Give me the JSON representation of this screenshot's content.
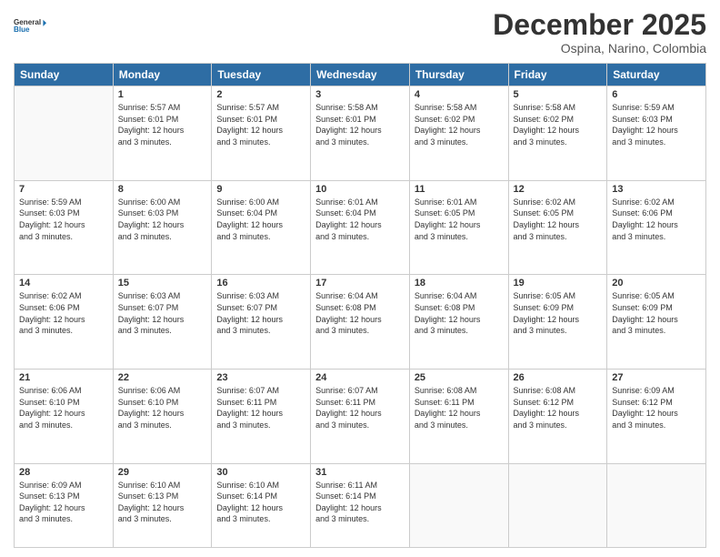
{
  "logo": {
    "line1": "General",
    "line2": "Blue"
  },
  "title": "December 2025",
  "subtitle": "Ospina, Narino, Colombia",
  "weekdays": [
    "Sunday",
    "Monday",
    "Tuesday",
    "Wednesday",
    "Thursday",
    "Friday",
    "Saturday"
  ],
  "weeks": [
    [
      {
        "day": "",
        "info": ""
      },
      {
        "day": "1",
        "info": "Sunrise: 5:57 AM\nSunset: 6:01 PM\nDaylight: 12 hours\nand 3 minutes."
      },
      {
        "day": "2",
        "info": "Sunrise: 5:57 AM\nSunset: 6:01 PM\nDaylight: 12 hours\nand 3 minutes."
      },
      {
        "day": "3",
        "info": "Sunrise: 5:58 AM\nSunset: 6:01 PM\nDaylight: 12 hours\nand 3 minutes."
      },
      {
        "day": "4",
        "info": "Sunrise: 5:58 AM\nSunset: 6:02 PM\nDaylight: 12 hours\nand 3 minutes."
      },
      {
        "day": "5",
        "info": "Sunrise: 5:58 AM\nSunset: 6:02 PM\nDaylight: 12 hours\nand 3 minutes."
      },
      {
        "day": "6",
        "info": "Sunrise: 5:59 AM\nSunset: 6:03 PM\nDaylight: 12 hours\nand 3 minutes."
      }
    ],
    [
      {
        "day": "7",
        "info": "Sunrise: 5:59 AM\nSunset: 6:03 PM\nDaylight: 12 hours\nand 3 minutes."
      },
      {
        "day": "8",
        "info": "Sunrise: 6:00 AM\nSunset: 6:03 PM\nDaylight: 12 hours\nand 3 minutes."
      },
      {
        "day": "9",
        "info": "Sunrise: 6:00 AM\nSunset: 6:04 PM\nDaylight: 12 hours\nand 3 minutes."
      },
      {
        "day": "10",
        "info": "Sunrise: 6:01 AM\nSunset: 6:04 PM\nDaylight: 12 hours\nand 3 minutes."
      },
      {
        "day": "11",
        "info": "Sunrise: 6:01 AM\nSunset: 6:05 PM\nDaylight: 12 hours\nand 3 minutes."
      },
      {
        "day": "12",
        "info": "Sunrise: 6:02 AM\nSunset: 6:05 PM\nDaylight: 12 hours\nand 3 minutes."
      },
      {
        "day": "13",
        "info": "Sunrise: 6:02 AM\nSunset: 6:06 PM\nDaylight: 12 hours\nand 3 minutes."
      }
    ],
    [
      {
        "day": "14",
        "info": "Sunrise: 6:02 AM\nSunset: 6:06 PM\nDaylight: 12 hours\nand 3 minutes."
      },
      {
        "day": "15",
        "info": "Sunrise: 6:03 AM\nSunset: 6:07 PM\nDaylight: 12 hours\nand 3 minutes."
      },
      {
        "day": "16",
        "info": "Sunrise: 6:03 AM\nSunset: 6:07 PM\nDaylight: 12 hours\nand 3 minutes."
      },
      {
        "day": "17",
        "info": "Sunrise: 6:04 AM\nSunset: 6:08 PM\nDaylight: 12 hours\nand 3 minutes."
      },
      {
        "day": "18",
        "info": "Sunrise: 6:04 AM\nSunset: 6:08 PM\nDaylight: 12 hours\nand 3 minutes."
      },
      {
        "day": "19",
        "info": "Sunrise: 6:05 AM\nSunset: 6:09 PM\nDaylight: 12 hours\nand 3 minutes."
      },
      {
        "day": "20",
        "info": "Sunrise: 6:05 AM\nSunset: 6:09 PM\nDaylight: 12 hours\nand 3 minutes."
      }
    ],
    [
      {
        "day": "21",
        "info": "Sunrise: 6:06 AM\nSunset: 6:10 PM\nDaylight: 12 hours\nand 3 minutes."
      },
      {
        "day": "22",
        "info": "Sunrise: 6:06 AM\nSunset: 6:10 PM\nDaylight: 12 hours\nand 3 minutes."
      },
      {
        "day": "23",
        "info": "Sunrise: 6:07 AM\nSunset: 6:11 PM\nDaylight: 12 hours\nand 3 minutes."
      },
      {
        "day": "24",
        "info": "Sunrise: 6:07 AM\nSunset: 6:11 PM\nDaylight: 12 hours\nand 3 minutes."
      },
      {
        "day": "25",
        "info": "Sunrise: 6:08 AM\nSunset: 6:11 PM\nDaylight: 12 hours\nand 3 minutes."
      },
      {
        "day": "26",
        "info": "Sunrise: 6:08 AM\nSunset: 6:12 PM\nDaylight: 12 hours\nand 3 minutes."
      },
      {
        "day": "27",
        "info": "Sunrise: 6:09 AM\nSunset: 6:12 PM\nDaylight: 12 hours\nand 3 minutes."
      }
    ],
    [
      {
        "day": "28",
        "info": "Sunrise: 6:09 AM\nSunset: 6:13 PM\nDaylight: 12 hours\nand 3 minutes."
      },
      {
        "day": "29",
        "info": "Sunrise: 6:10 AM\nSunset: 6:13 PM\nDaylight: 12 hours\nand 3 minutes."
      },
      {
        "day": "30",
        "info": "Sunrise: 6:10 AM\nSunset: 6:14 PM\nDaylight: 12 hours\nand 3 minutes."
      },
      {
        "day": "31",
        "info": "Sunrise: 6:11 AM\nSunset: 6:14 PM\nDaylight: 12 hours\nand 3 minutes."
      },
      {
        "day": "",
        "info": ""
      },
      {
        "day": "",
        "info": ""
      },
      {
        "day": "",
        "info": ""
      }
    ]
  ]
}
